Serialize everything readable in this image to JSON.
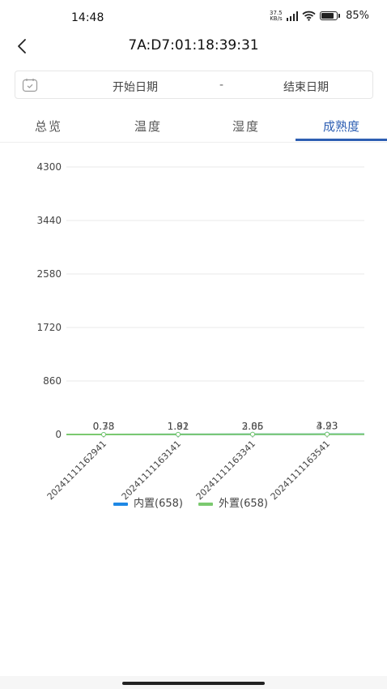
{
  "status_bar": {
    "time": "14:48",
    "net_speed_value": "37.5",
    "net_speed_unit": "KB/s",
    "battery_percent": 85,
    "battery_text": "85%"
  },
  "nav": {
    "title": "7A:D7:01:18:39:31"
  },
  "date_range": {
    "start_placeholder": "开始日期",
    "separator": "-",
    "end_placeholder": "结束日期"
  },
  "tabs": [
    {
      "label": "总览"
    },
    {
      "label": "温度"
    },
    {
      "label": "湿度"
    },
    {
      "label": "成熟度",
      "active": true
    }
  ],
  "chart_data": {
    "type": "line",
    "categories": [
      "20241111162941",
      "20241111163141",
      "20241111163341",
      "20241111163541"
    ],
    "y_ticks": [
      "4300",
      "3440",
      "2580",
      "1720",
      "860",
      "0"
    ],
    "ylim": [
      0,
      4300
    ],
    "grid": true,
    "legend_position": "bottom",
    "series": [
      {
        "name": "内置(658)",
        "color": "#1e88e5",
        "values": [
          0.78,
          1.92,
          3.06,
          4.23
        ],
        "labels": [
          "0.78",
          "1.92",
          "3.06",
          "4.23"
        ]
      },
      {
        "name": "外置(658)",
        "color": "#7bc96f",
        "values": [
          0.33,
          1.81,
          2.85,
          3.93
        ],
        "labels": [
          "0.33",
          "1.81",
          "2.85",
          "3.93"
        ]
      }
    ]
  }
}
